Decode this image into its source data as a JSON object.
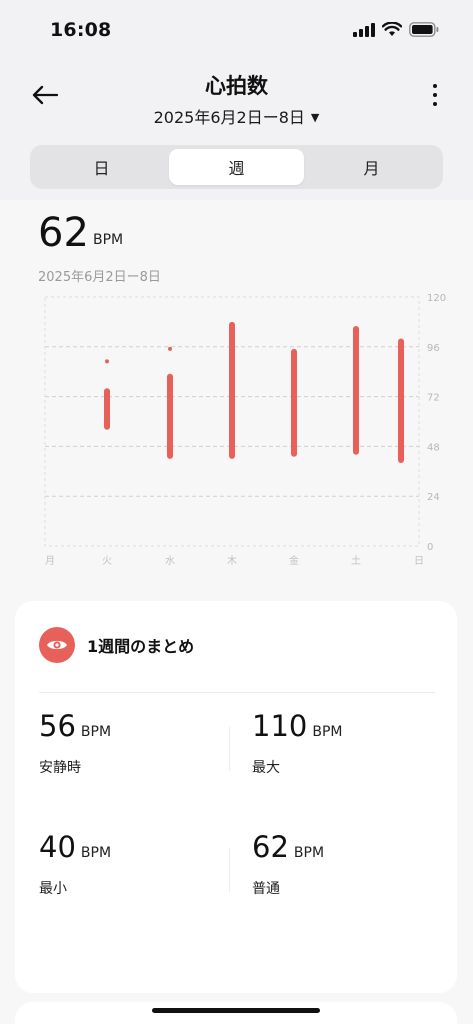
{
  "status_bar": {
    "time": "16:08"
  },
  "header": {
    "title": "心拍数",
    "date_range": "2025年6月2日ー8日"
  },
  "tabs": [
    {
      "label": "日",
      "active": false
    },
    {
      "label": "週",
      "active": true
    },
    {
      "label": "月",
      "active": false
    }
  ],
  "summary_top": {
    "value": "62",
    "unit": "BPM",
    "date": "2025年6月2日ー8日"
  },
  "chart_data": {
    "type": "bar",
    "subtype": "range",
    "categories": [
      "月",
      "火",
      "水",
      "木",
      "金",
      "土",
      "日"
    ],
    "y_ticks": [
      0,
      24,
      48,
      72,
      96,
      120
    ],
    "ylim": [
      0,
      120
    ],
    "grid": true,
    "color": "#e8605a",
    "series": [
      {
        "ranges": [
          null,
          {
            "min": 56,
            "max": 76
          },
          {
            "min": 42,
            "max": 83
          },
          {
            "min": 42,
            "max": 108
          },
          {
            "min": 43,
            "max": 95
          },
          {
            "min": 44,
            "max": 106
          },
          {
            "min": 40,
            "max": 100
          }
        ],
        "outliers": [
          null,
          {
            "value": 89
          },
          {
            "value": 95
          },
          null,
          null,
          null,
          null
        ]
      }
    ]
  },
  "card": {
    "title": "1週間のまとめ",
    "stats": [
      {
        "value": "56",
        "unit": "BPM",
        "label": "安静時"
      },
      {
        "value": "110",
        "unit": "BPM",
        "label": "最大"
      },
      {
        "value": "40",
        "unit": "BPM",
        "label": "最小"
      },
      {
        "value": "62",
        "unit": "BPM",
        "label": "普通"
      }
    ]
  },
  "colors": {
    "accent": "#e8605a",
    "background": "#f2f2f4"
  },
  "icons": [
    "back-arrow-icon",
    "more-vertical-icon",
    "caret-down-icon",
    "eye-icon",
    "signal-icon",
    "wifi-icon",
    "battery-icon"
  ]
}
